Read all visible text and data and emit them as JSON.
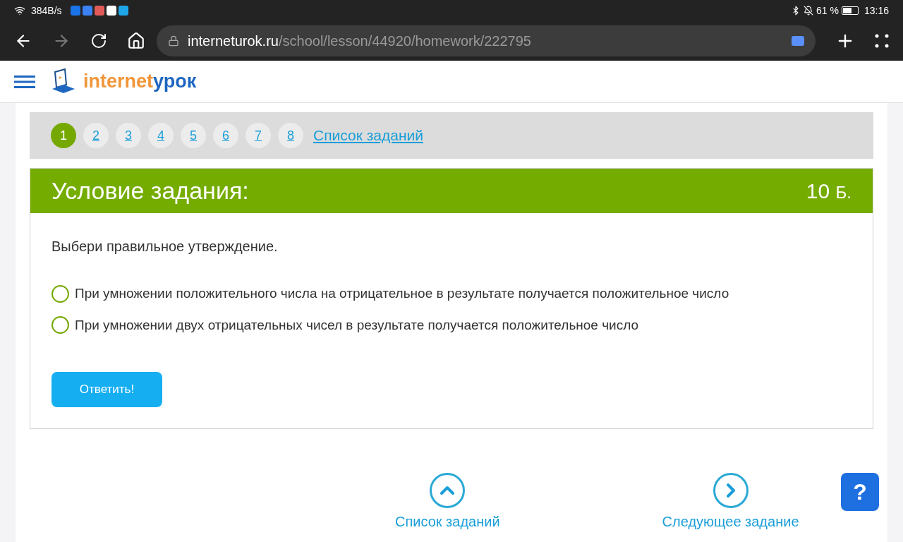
{
  "status_bar": {
    "speed": "384B/s",
    "battery": "61 %",
    "time": "13:16"
  },
  "browser": {
    "url_domain": "interneturok.ru",
    "url_path": "/school/lesson/44920/homework/222795"
  },
  "site": {
    "logo_part_1": "internet",
    "logo_part_2": "урок"
  },
  "task_nav": {
    "items": [
      {
        "label": "1",
        "selected": true
      },
      {
        "label": "2",
        "selected": false
      },
      {
        "label": "3",
        "selected": false
      },
      {
        "label": "4",
        "selected": false
      },
      {
        "label": "5",
        "selected": false
      },
      {
        "label": "6",
        "selected": false
      },
      {
        "label": "7",
        "selected": false
      },
      {
        "label": "8",
        "selected": false
      }
    ],
    "list_link": "Список заданий"
  },
  "task": {
    "title": "Условие задания:",
    "points": "10",
    "points_unit": "Б.",
    "question": "Выбери правильное утверждение.",
    "options": [
      {
        "label": "При умножении положительного числа на отрицательное в результате получается положительное число",
        "selected": false
      },
      {
        "label": "При умножении двух отрицательных чисел в результате получается положительное число",
        "selected": false
      }
    ],
    "submit": "Ответить!"
  },
  "bottom_nav": [
    {
      "kind": "up",
      "label": "Список заданий"
    },
    {
      "kind": "next",
      "label": "Следующее задание"
    }
  ],
  "help": "?"
}
